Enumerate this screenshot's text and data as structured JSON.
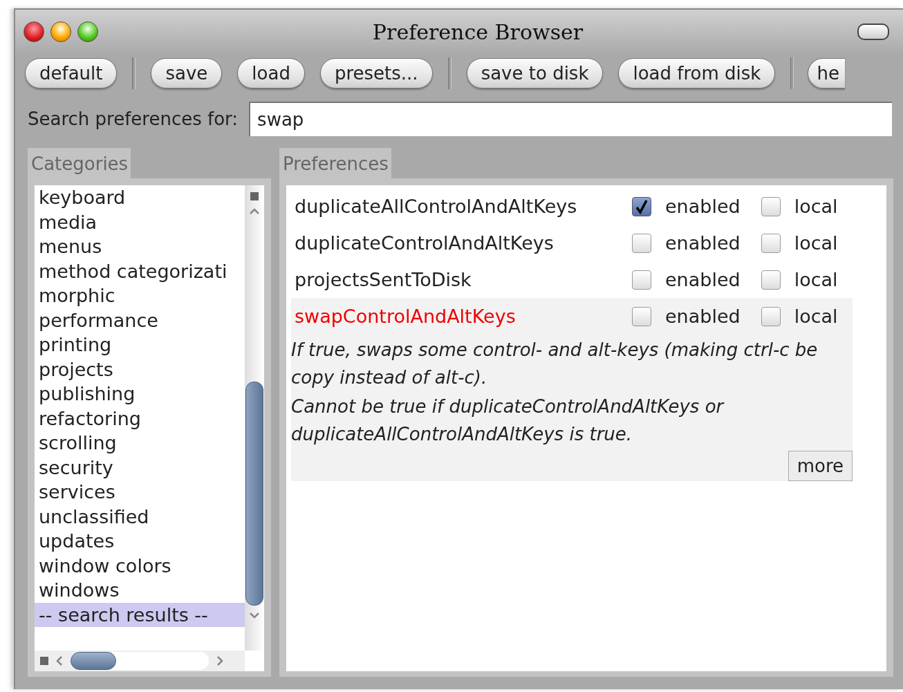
{
  "window": {
    "title": "Preference Browser"
  },
  "toolbar": [
    {
      "kind": "button",
      "label": "default"
    },
    {
      "kind": "separator"
    },
    {
      "kind": "button",
      "label": "save"
    },
    {
      "kind": "button",
      "label": "load"
    },
    {
      "kind": "button",
      "label": "presets..."
    },
    {
      "kind": "separator"
    },
    {
      "kind": "button",
      "label": "save to disk"
    },
    {
      "kind": "button",
      "label": "load from disk"
    },
    {
      "kind": "separator"
    },
    {
      "kind": "cut",
      "label": "he"
    }
  ],
  "search": {
    "label": "Search preferences for:",
    "value": "swap"
  },
  "categories": {
    "title": "Categories",
    "items": [
      {
        "label": "keyboard",
        "selected": false
      },
      {
        "label": "media",
        "selected": false
      },
      {
        "label": "menus",
        "selected": false
      },
      {
        "label": "method categorizati",
        "selected": false
      },
      {
        "label": "morphic",
        "selected": false
      },
      {
        "label": "performance",
        "selected": false
      },
      {
        "label": "printing",
        "selected": false
      },
      {
        "label": "projects",
        "selected": false
      },
      {
        "label": "publishing",
        "selected": false
      },
      {
        "label": "refactoring",
        "selected": false
      },
      {
        "label": "scrolling",
        "selected": false
      },
      {
        "label": "security",
        "selected": false
      },
      {
        "label": "services",
        "selected": false
      },
      {
        "label": "unclassified",
        "selected": false
      },
      {
        "label": "updates",
        "selected": false
      },
      {
        "label": "window colors",
        "selected": false
      },
      {
        "label": "windows",
        "selected": false
      },
      {
        "label": "-- search results --",
        "selected": true
      }
    ]
  },
  "preferences": {
    "title": "Preferences",
    "items": [
      {
        "name": "duplicateAllControlAndAltKeys",
        "enabled": true,
        "enabled_label": "enabled",
        "local": false,
        "local_label": "local",
        "selected": false
      },
      {
        "name": "duplicateControlAndAltKeys",
        "enabled": false,
        "enabled_label": "enabled",
        "local": false,
        "local_label": "local",
        "selected": false
      },
      {
        "name": "projectsSentToDisk",
        "enabled": false,
        "enabled_label": "enabled",
        "local": false,
        "local_label": "local",
        "selected": false
      },
      {
        "name": "swapControlAndAltKeys",
        "enabled": false,
        "enabled_label": "enabled",
        "local": false,
        "local_label": "local",
        "selected": true,
        "description": [
          "If true, swaps some control- and alt-keys (making ctrl-c be copy instead of alt-c).",
          "Cannot be true if duplicateControlAndAltKeys or duplicateAllControlAndAltKeys is true."
        ],
        "more": "more"
      }
    ]
  }
}
